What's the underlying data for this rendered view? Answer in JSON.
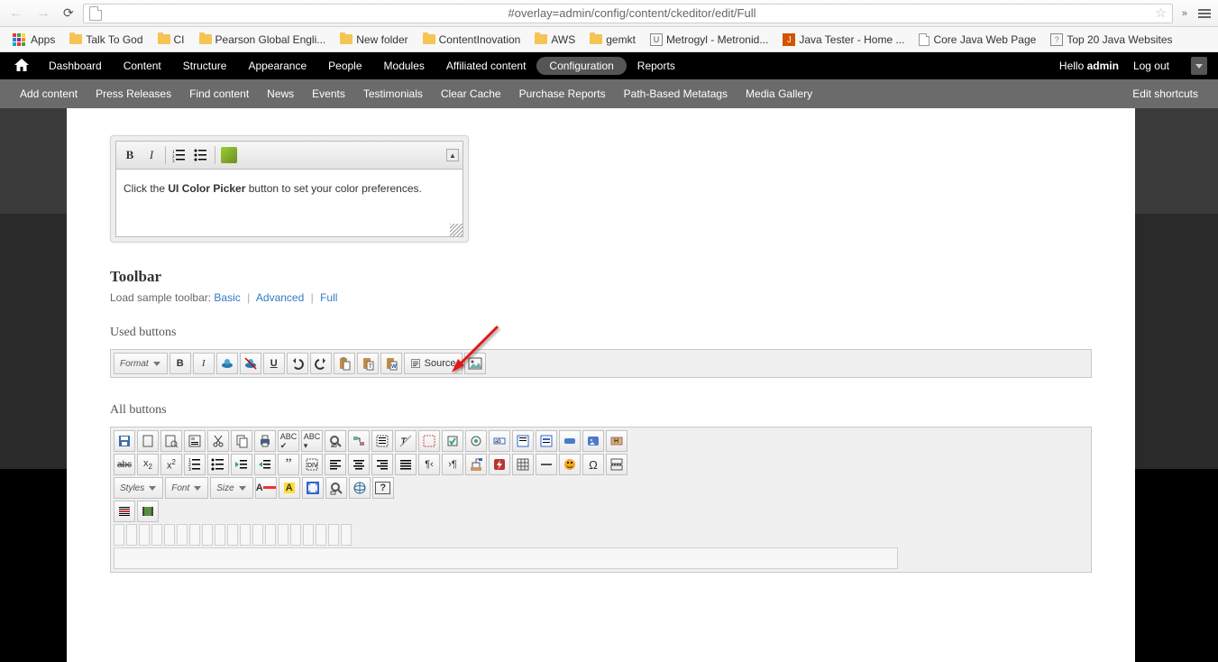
{
  "browser": {
    "url": "#overlay=admin/config/content/ckeditor/edit/Full",
    "chevrons": "»"
  },
  "bookmarks": {
    "apps": "Apps",
    "items": [
      {
        "label": "Talk To God",
        "type": "folder"
      },
      {
        "label": "CI",
        "type": "folder"
      },
      {
        "label": "Pearson Global Engli...",
        "type": "folder"
      },
      {
        "label": "New folder",
        "type": "folder"
      },
      {
        "label": "ContentInovation",
        "type": "folder"
      },
      {
        "label": "AWS",
        "type": "folder"
      },
      {
        "label": "gemkt",
        "type": "folder"
      },
      {
        "label": "Metrogyl - Metronid...",
        "type": "u"
      },
      {
        "label": "Java Tester - Home ...",
        "type": "j"
      },
      {
        "label": "Core Java Web Page",
        "type": "doc"
      },
      {
        "label": "Top 20 Java Websites",
        "type": "q"
      }
    ]
  },
  "adminMenu": {
    "items": [
      "Dashboard",
      "Content",
      "Structure",
      "Appearance",
      "People",
      "Modules",
      "Affiliated content",
      "Configuration",
      "Reports"
    ],
    "activeIndex": 7,
    "helloPrefix": "Hello ",
    "helloUser": "admin",
    "logout": "Log out"
  },
  "subMenu": {
    "items": [
      "Add content",
      "Press Releases",
      "Find content",
      "News",
      "Events",
      "Testimonials",
      "Clear Cache",
      "Purchase Reports",
      "Path-Based Metatags",
      "Media Gallery"
    ],
    "right": "Edit shortcuts"
  },
  "ckeditor": {
    "helpTextPrefix": "Click the ",
    "helpTextBold": "UI Color Picker",
    "helpTextSuffix": " button to set your color preferences."
  },
  "headings": {
    "toolbar": "Toolbar",
    "sampleLabel": "Load sample toolbar:",
    "sampleBasic": "Basic",
    "sampleAdvanced": "Advanced",
    "sampleFull": "Full",
    "used": "Used buttons",
    "all": "All buttons"
  },
  "used": {
    "format": "Format",
    "source": "Source"
  },
  "all": {
    "styles": "Styles",
    "font": "Font",
    "size": "Size"
  }
}
